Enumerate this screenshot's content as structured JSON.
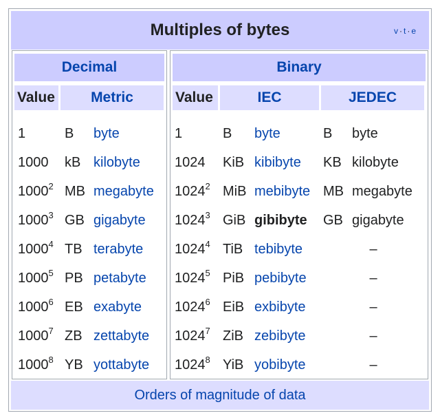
{
  "title": "Multiples of bytes",
  "vte": {
    "v": "v",
    "t": "t",
    "e": "e",
    "sep": "·"
  },
  "decimal": {
    "heading": "Decimal",
    "headers": {
      "value": "Value",
      "metric": "Metric"
    },
    "rows": [
      {
        "base": "1",
        "exp": "",
        "symbol": "B",
        "name": "byte"
      },
      {
        "base": "1000",
        "exp": "",
        "symbol": "kB",
        "name": "kilobyte"
      },
      {
        "base": "1000",
        "exp": "2",
        "symbol": "MB",
        "name": "megabyte"
      },
      {
        "base": "1000",
        "exp": "3",
        "symbol": "GB",
        "name": "gigabyte"
      },
      {
        "base": "1000",
        "exp": "4",
        "symbol": "TB",
        "name": "terabyte"
      },
      {
        "base": "1000",
        "exp": "5",
        "symbol": "PB",
        "name": "petabyte"
      },
      {
        "base": "1000",
        "exp": "6",
        "symbol": "EB",
        "name": "exabyte"
      },
      {
        "base": "1000",
        "exp": "7",
        "symbol": "ZB",
        "name": "zettabyte"
      },
      {
        "base": "1000",
        "exp": "8",
        "symbol": "YB",
        "name": "yottabyte"
      }
    ]
  },
  "binary": {
    "heading": "Binary",
    "headers": {
      "value": "Value",
      "iec": "IEC",
      "jedec": "JEDEC"
    },
    "rows": [
      {
        "base": "1",
        "exp": "",
        "iec_symbol": "B",
        "iec_name": "byte",
        "jedec_symbol": "B",
        "jedec_name": "byte",
        "jedec_dash": ""
      },
      {
        "base": "1024",
        "exp": "",
        "iec_symbol": "KiB",
        "iec_name": "kibibyte",
        "jedec_symbol": "KB",
        "jedec_name": "kilobyte",
        "jedec_dash": ""
      },
      {
        "base": "1024",
        "exp": "2",
        "iec_symbol": "MiB",
        "iec_name": "mebibyte",
        "jedec_symbol": "MB",
        "jedec_name": "megabyte",
        "jedec_dash": ""
      },
      {
        "base": "1024",
        "exp": "3",
        "iec_symbol": "GiB",
        "iec_name": "gibibyte",
        "jedec_symbol": "GB",
        "jedec_name": "gigabyte",
        "jedec_dash": ""
      },
      {
        "base": "1024",
        "exp": "4",
        "iec_symbol": "TiB",
        "iec_name": "tebibyte",
        "jedec_symbol": "",
        "jedec_name": "",
        "jedec_dash": "–"
      },
      {
        "base": "1024",
        "exp": "5",
        "iec_symbol": "PiB",
        "iec_name": "pebibyte",
        "jedec_symbol": "",
        "jedec_name": "",
        "jedec_dash": "–"
      },
      {
        "base": "1024",
        "exp": "6",
        "iec_symbol": "EiB",
        "iec_name": "exbibyte",
        "jedec_symbol": "",
        "jedec_name": "",
        "jedec_dash": "–"
      },
      {
        "base": "1024",
        "exp": "7",
        "iec_symbol": "ZiB",
        "iec_name": "zebibyte",
        "jedec_symbol": "",
        "jedec_name": "",
        "jedec_dash": "–"
      },
      {
        "base": "1024",
        "exp": "8",
        "iec_symbol": "YiB",
        "iec_name": "yobibyte",
        "jedec_symbol": "",
        "jedec_name": "",
        "jedec_dash": "–"
      }
    ]
  },
  "footer": {
    "link": "Orders of magnitude of data"
  },
  "colors": {
    "title_bg": "#ccccff",
    "header_bg": "#ddddff",
    "link": "#0645ad",
    "border": "#a2a9b1"
  }
}
